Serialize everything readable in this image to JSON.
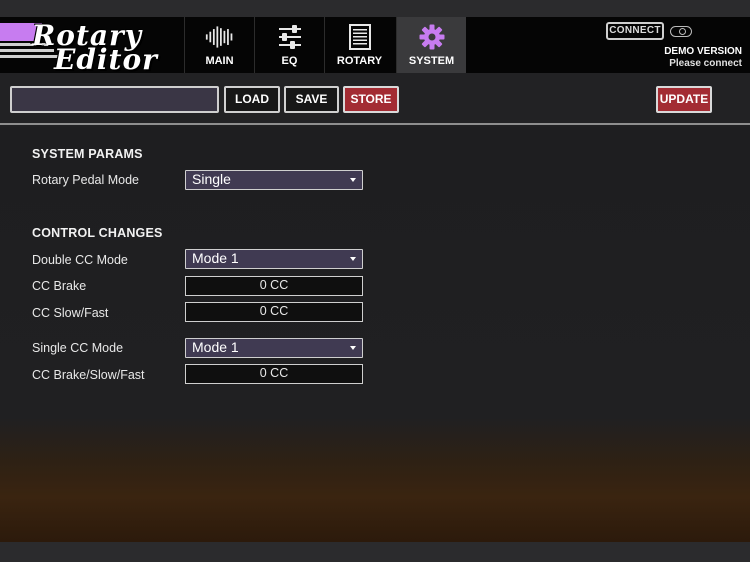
{
  "brand": {
    "line1": "Rotary",
    "line2": "Editor"
  },
  "tabs": [
    {
      "label": "MAIN",
      "icon": "waveform-icon"
    },
    {
      "label": "EQ",
      "icon": "sliders-icon"
    },
    {
      "label": "ROTARY",
      "icon": "speaker-icon"
    },
    {
      "label": "SYSTEM",
      "icon": "gear-icon",
      "active": true
    }
  ],
  "connect": {
    "label": "CONNECT",
    "status": "DEMO VERSION",
    "hint": "Please connect"
  },
  "toolbar": {
    "preset_value": "",
    "load_label": "LOAD",
    "save_label": "SAVE",
    "store_label": "STORE",
    "update_label": "UPDATE"
  },
  "system_params": {
    "title": "SYSTEM PARAMS",
    "rotary_pedal_mode": {
      "label": "Rotary Pedal Mode",
      "value": "Single"
    }
  },
  "control_changes": {
    "title": "CONTROL CHANGES",
    "double_cc_mode": {
      "label": "Double CC Mode",
      "value": "Mode 1"
    },
    "cc_brake": {
      "label": "CC Brake",
      "value": "0 CC"
    },
    "cc_slow_fast": {
      "label": "CC Slow/Fast",
      "value": "0 CC"
    },
    "single_cc_mode": {
      "label": "Single CC Mode",
      "value": "Mode 1"
    },
    "cc_brake_slow_fast": {
      "label": "CC Brake/Slow/Fast",
      "value": "0 CC"
    }
  },
  "colors": {
    "accent": "#c77cf0",
    "red_button": "#a32c33",
    "select_bg": "#403a52"
  }
}
